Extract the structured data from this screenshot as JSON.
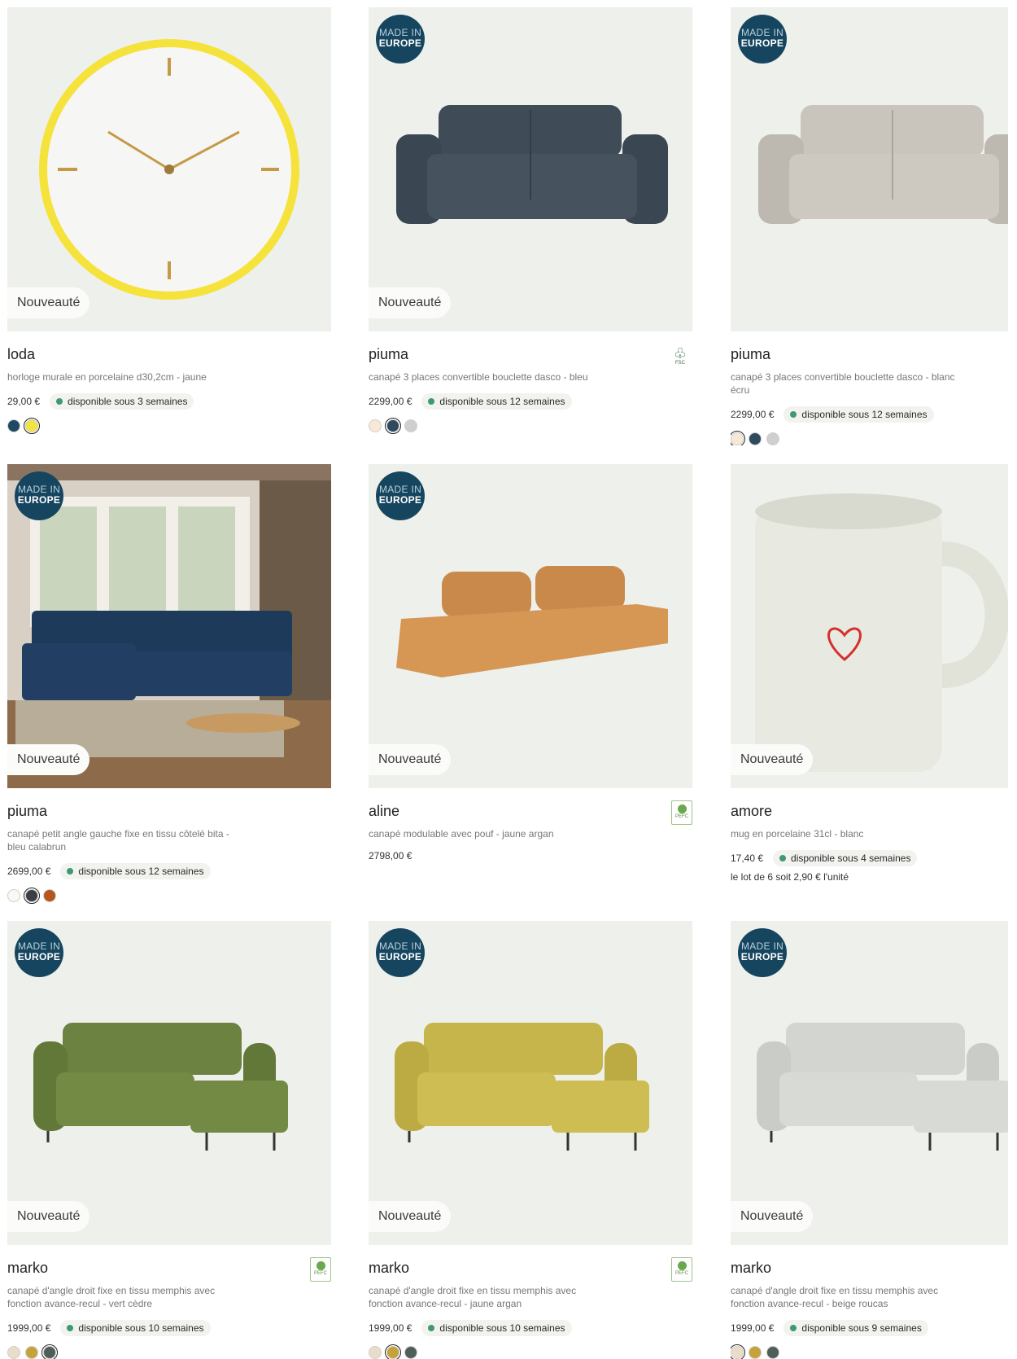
{
  "badges": {
    "new": "Nouveauté",
    "made_top": "MADE IN",
    "made_bottom": "EUROPE",
    "pefc": "PEFC",
    "fsc": "FSC"
  },
  "products": [
    {
      "name": "loda",
      "desc": "horloge murale en porcelaine d30,2cm - jaune",
      "price": "29,00 €",
      "availability": "disponible sous 3 semaines",
      "swatches": [
        "#1f4963",
        "#f1e441"
      ],
      "selected": 1,
      "image": "yellow clock"
    },
    {
      "name": "piuma",
      "desc": "canapé 3 places convertible bouclette dasco - bleu",
      "price": "2299,00 €",
      "availability": "disponible sous 12 semaines",
      "swatches": [
        "#f7e9d6",
        "#2d4a5e",
        "#cfcfcf"
      ],
      "selected": 1,
      "image": "dark blue sofa",
      "label": "fsc"
    },
    {
      "name": "piuma",
      "desc": "canapé 3 places convertible bouclette dasco - blanc écru",
      "price": "2299,00 €",
      "availability": "disponible sous 12 semaines",
      "swatches": [
        "#f7e9d6",
        "#2d4a5e",
        "#cfcfcf"
      ],
      "selected": 0,
      "image": "beige sofa"
    },
    {
      "name": "piuma",
      "desc": "canapé petit angle gauche fixe en tissu côtelé bita - bleu calabrun",
      "price": "2699,00 €",
      "availability": "disponible sous 12 semaines",
      "swatches": [
        "#f9f8f3",
        "#3a3f45",
        "#b5561c"
      ],
      "selected": 1,
      "image": "living room blue sofa"
    },
    {
      "name": "aline",
      "desc": "canapé modulable avec pouf - jaune argan",
      "price": "2798,00 €",
      "availability": "",
      "swatches": [],
      "selected": -1,
      "image": "orange modular sofa",
      "label": "pefc"
    },
    {
      "name": "amore",
      "desc": "mug en porcelaine 31cl - blanc",
      "price": "17,40 €",
      "availability": "disponible sous 4 semaines",
      "lot": "le lot de 6 soit 2,90 € l'unité",
      "swatches": [],
      "selected": -1,
      "image": "white mug"
    },
    {
      "name": "marko",
      "desc": "canapé d'angle droit fixe en tissu memphis avec fonction avance-recul - vert cèdre",
      "price": "1999,00 €",
      "availability": "disponible sous 10 semaines",
      "swatches": [
        "#e9dcc9",
        "#c6a23a",
        "#4f5e58"
      ],
      "selected": 2,
      "image": "green sofa",
      "label": "pefc"
    },
    {
      "name": "marko",
      "desc": "canapé d'angle droit fixe en tissu memphis avec fonction avance-recul - jaune argan",
      "price": "1999,00 €",
      "availability": "disponible sous 10 semaines",
      "swatches": [
        "#e9dcc9",
        "#c6a23a",
        "#4f5e58"
      ],
      "selected": 1,
      "image": "yellow sofa",
      "label": "pefc"
    },
    {
      "name": "marko",
      "desc": "canapé d'angle droit fixe en tissu memphis avec fonction avance-recul - beige roucas",
      "price": "1999,00 €",
      "availability": "disponible sous 9 semaines",
      "swatches": [
        "#e9dcc9",
        "#c6a23a",
        "#4f5e58"
      ],
      "selected": 0,
      "image": "white sofa"
    }
  ]
}
